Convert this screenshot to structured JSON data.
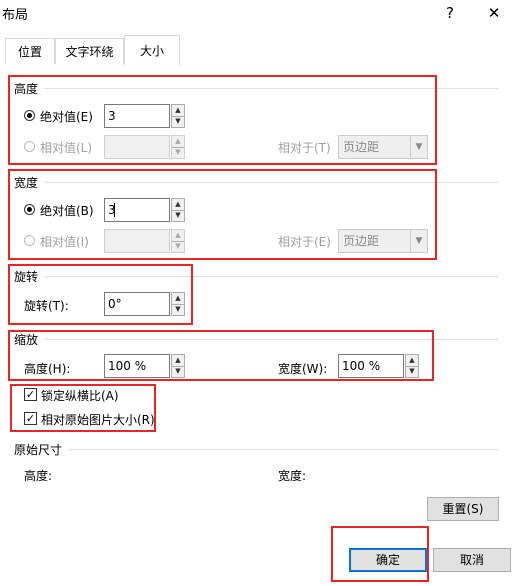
{
  "window": {
    "title": "布局",
    "help_glyph": "?",
    "close_glyph": "✕"
  },
  "tabs": [
    {
      "label": "位置",
      "active": false
    },
    {
      "label": "文字环绕",
      "active": false
    },
    {
      "label": "大小",
      "active": true
    }
  ],
  "height_section": {
    "title": "高度",
    "absolute_label": "绝对值(E)",
    "absolute_value": "3",
    "relative_label": "相对值(L)",
    "relative_value": "",
    "relative_to_label": "相对于(T)",
    "relative_to_value": "页边距"
  },
  "width_section": {
    "title": "宽度",
    "absolute_label": "绝对值(B)",
    "absolute_value": "3",
    "relative_label": "相对值(I)",
    "relative_value": "",
    "relative_to_label": "相对于(E)",
    "relative_to_value": "页边距"
  },
  "rotation_section": {
    "title": "旋转",
    "rotation_label": "旋转(T):",
    "rotation_value": "0°"
  },
  "scale_section": {
    "title": "缩放",
    "height_label": "高度(H):",
    "height_value": "100 %",
    "width_label": "宽度(W):",
    "width_value": "100 %",
    "lock_aspect_label": "锁定纵横比(A)",
    "lock_aspect_checked": true,
    "relative_original_label": "相对原始图片大小(R)",
    "relative_original_checked": true
  },
  "original_size_section": {
    "title": "原始尺寸",
    "height_label": "高度:",
    "width_label": "宽度:",
    "reset_label": "重置(S)"
  },
  "footer": {
    "ok_label": "确定",
    "cancel_label": "取消"
  },
  "colors": {
    "highlight_red": "#e8262a",
    "primary_border": "#0078d7"
  }
}
